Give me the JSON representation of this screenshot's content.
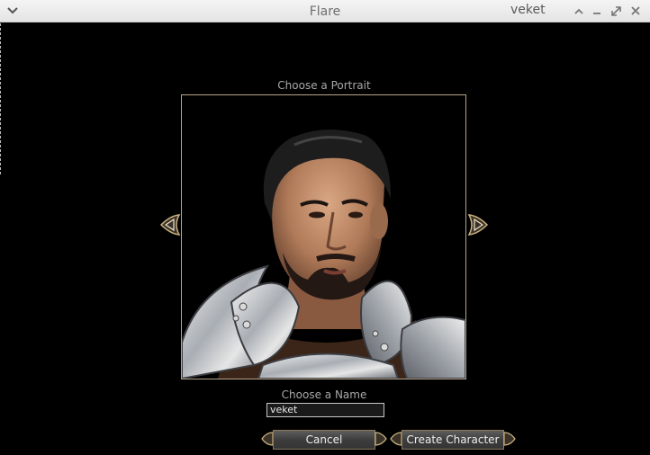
{
  "window": {
    "title": "Flare",
    "user": "veket",
    "menu_icon": "chevron-down-icon",
    "controls": [
      "chevron-up-icon",
      "minimize-icon",
      "maximize-icon",
      "close-icon"
    ]
  },
  "portrait": {
    "heading": "Choose a Portrait",
    "prev_icon": "arrow-left-icon",
    "next_icon": "arrow-right-icon"
  },
  "name": {
    "heading": "Choose a Name",
    "value": "veket"
  },
  "buttons": {
    "cancel": "Cancel",
    "create": "Create Character"
  },
  "colors": {
    "background": "#000000",
    "frame_border": "#b5a58a",
    "text": "#a8a8a8"
  }
}
